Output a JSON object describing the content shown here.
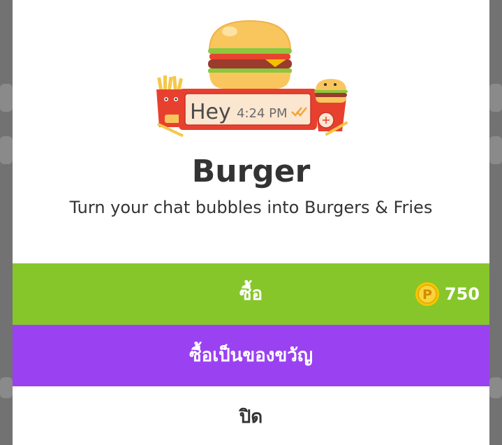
{
  "sticker": {
    "bubble_text": "Hey",
    "bubble_time": "4:24 PM",
    "read_icon": "double-check-icon"
  },
  "theme": {
    "title": "Burger",
    "description": "Turn your chat bubbles into Burgers & Fries"
  },
  "actions": {
    "buy_label": "ซื้อ",
    "gift_label": "ซื้อเป็นของขวัญ",
    "close_label": "ปิด"
  },
  "price": {
    "currency_icon": "p-coin-icon",
    "currency_letter": "P",
    "amount": "750"
  },
  "colors": {
    "buy": "#86c62b",
    "gift": "#9a41f2",
    "coin": "#f7c500"
  }
}
